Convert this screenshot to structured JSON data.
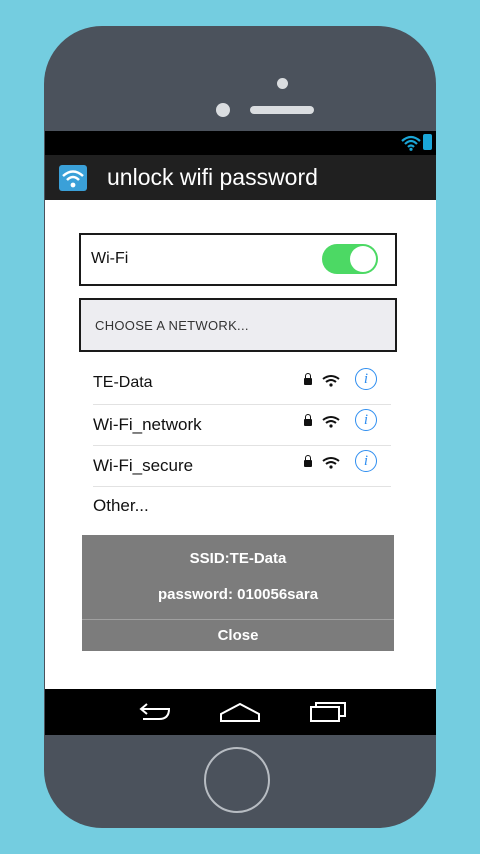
{
  "app": {
    "title": "unlock wifi password",
    "icon": "wifi-icon"
  },
  "status_bar": {
    "icons": [
      "wifi-icon",
      "battery-icon"
    ]
  },
  "wifi_toggle": {
    "label": "Wi-Fi",
    "enabled": true,
    "on_color": "#4cd964"
  },
  "network_header": {
    "label": "CHOOSE A NETWORK..."
  },
  "networks": [
    {
      "name": "TE-Data",
      "icons": [
        "lock-icon",
        "wifi-icon",
        "info-icon"
      ]
    },
    {
      "name": "Wi-Fi_network",
      "icons": [
        "lock-icon",
        "wifi-icon",
        "info-icon"
      ]
    },
    {
      "name": "Wi-Fi_secure",
      "icons": [
        "lock-icon",
        "wifi-icon",
        "info-icon"
      ]
    }
  ],
  "other": {
    "label": "Other..."
  },
  "dialog": {
    "ssid": "SSID:TE-Data",
    "password": "password: 010056sara",
    "close_label": "Close"
  },
  "nav_bar": {
    "buttons": [
      "back-icon",
      "home-icon",
      "recents-icon"
    ]
  },
  "info_glyph": "i",
  "colors": {
    "background": "#74cde0",
    "phone_body": "#4b525c",
    "accent": "#2f8ef0",
    "dialog": "#7c7c7c"
  }
}
